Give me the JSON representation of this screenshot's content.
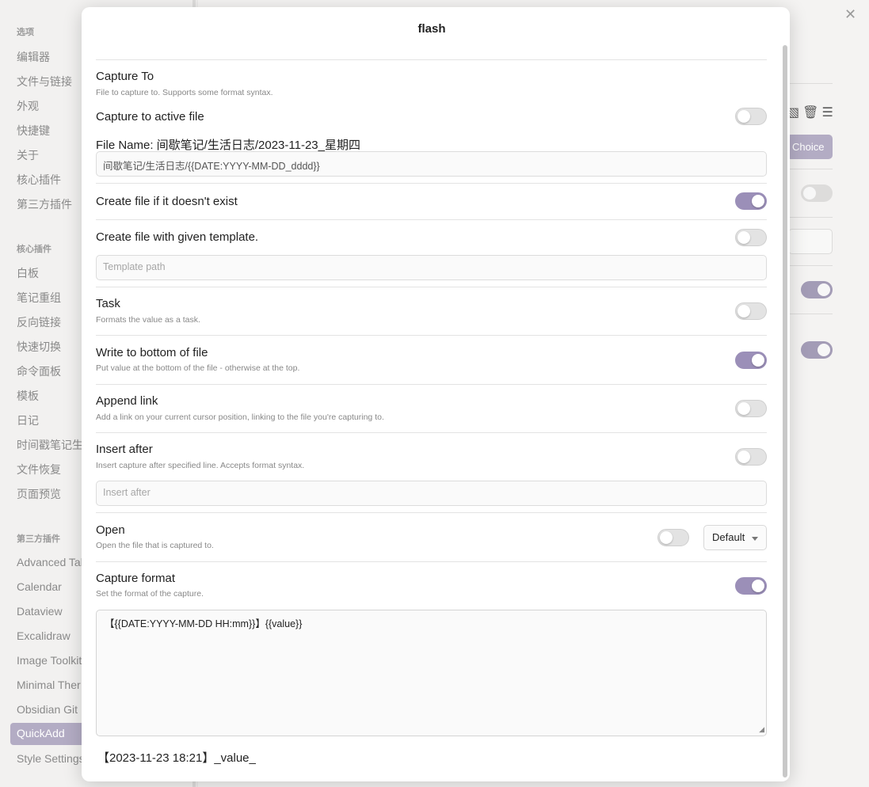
{
  "sidebar": {
    "groups": [
      {
        "title": "选项",
        "items": [
          "编辑器",
          "文件与链接",
          "外观",
          "快捷键",
          "关于",
          "核心插件",
          "第三方插件"
        ]
      },
      {
        "title": "核心插件",
        "items": [
          "白板",
          "笔记重组",
          "反向链接",
          "快速切换",
          "命令面板",
          "模板",
          "日记",
          "时间戳笔记生",
          "文件恢复",
          "页面预览"
        ]
      },
      {
        "title": "第三方插件",
        "items": [
          "Advanced Tab",
          "Calendar",
          "Dataview",
          "Excalidraw",
          "Image Toolkit",
          "Minimal Ther",
          "Obsidian Git",
          "QuickAdd",
          "Style Settings"
        ]
      }
    ],
    "active_item": "QuickAdd"
  },
  "background": {
    "close_glyph": "✕",
    "choice_button": "Choice",
    "icons": [
      "comment-icon",
      "trash-icon",
      "menu-icon"
    ]
  },
  "modal": {
    "title": "flash",
    "accent_color": "#9b8fb8",
    "capture_to": {
      "label": "Capture To",
      "desc": "File to capture to. Supports some format syntax."
    },
    "capture_active": {
      "label": "Capture to active file",
      "on": false
    },
    "file_name": {
      "label": "File Name: 间歇笔记/生活日志/2023-11-23_星期四",
      "value": "间歇笔记/生活日志/{{DATE:YYYY-MM-DD_dddd}}"
    },
    "create_if_missing": {
      "label": "Create file if it doesn't exist",
      "on": true
    },
    "create_with_template": {
      "label": "Create file with given template.",
      "on": false,
      "placeholder": "Template path"
    },
    "task": {
      "label": "Task",
      "desc": "Formats the value as a task.",
      "on": false
    },
    "write_bottom": {
      "label": "Write to bottom of file",
      "desc": "Put value at the bottom of the file - otherwise at the top.",
      "on": true
    },
    "append_link": {
      "label": "Append link",
      "desc": "Add a link on your current cursor position, linking to the file you're capturing to.",
      "on": false
    },
    "insert_after": {
      "label": "Insert after",
      "desc": "Insert capture after specified line. Accepts format syntax.",
      "on": false,
      "placeholder": "Insert after"
    },
    "open": {
      "label": "Open",
      "desc": "Open the file that is captured to.",
      "on": false,
      "dropdown_value": "Default"
    },
    "capture_format": {
      "label": "Capture format",
      "desc": "Set the format of the capture.",
      "on": true,
      "value": "【{{DATE:YYYY-MM-DD HH:mm}}】{{value}}"
    },
    "preview": "【2023-11-23 18:21】_value_"
  }
}
